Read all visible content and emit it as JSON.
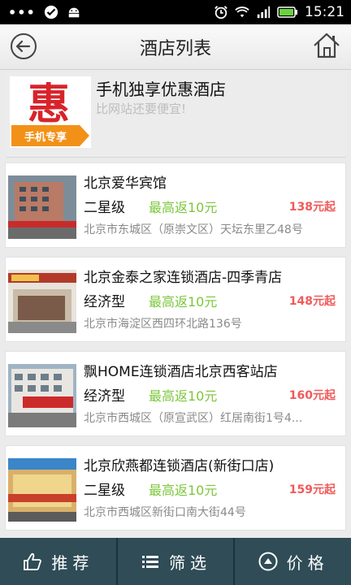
{
  "status_bar": {
    "time": "15:21"
  },
  "nav": {
    "title": "酒店列表"
  },
  "promo": {
    "title": "手机独享优惠酒店",
    "subtitle": "比网站还要便宜!",
    "logo_char": "惠",
    "logo_tag": "手机专享"
  },
  "hotels": [
    {
      "name": "北京爱华宾馆",
      "type": "二星级",
      "rebate": "最高返10元",
      "price": "138元起",
      "address": "北京市东城区（原崇文区）天坛东里乙48号"
    },
    {
      "name": "北京金泰之家连锁酒店-四季青店",
      "type": "经济型",
      "rebate": "最高返10元",
      "price": "148元起",
      "address": "北京市海淀区西四环北路136号"
    },
    {
      "name": "飘HOME连锁酒店北京西客站店",
      "type": "经济型",
      "rebate": "最高返10元",
      "price": "160元起",
      "address": "北京市西城区（原宣武区）红居南街1号4..."
    },
    {
      "name": "北京欣燕都连锁酒店(新街口店)",
      "type": "二星级",
      "rebate": "最高返10元",
      "price": "159元起",
      "address": "北京市西城区新街口南大街44号"
    }
  ],
  "tabs": [
    {
      "label": "推荐",
      "icon": "thumbs-up-icon"
    },
    {
      "label": "筛选",
      "icon": "list-icon"
    },
    {
      "label": "价格",
      "icon": "up-arrow-circle-icon"
    }
  ],
  "colors": {
    "rebate": "#7cc63a",
    "price": "#f15a5a",
    "tabbar": "#2f4c57"
  }
}
